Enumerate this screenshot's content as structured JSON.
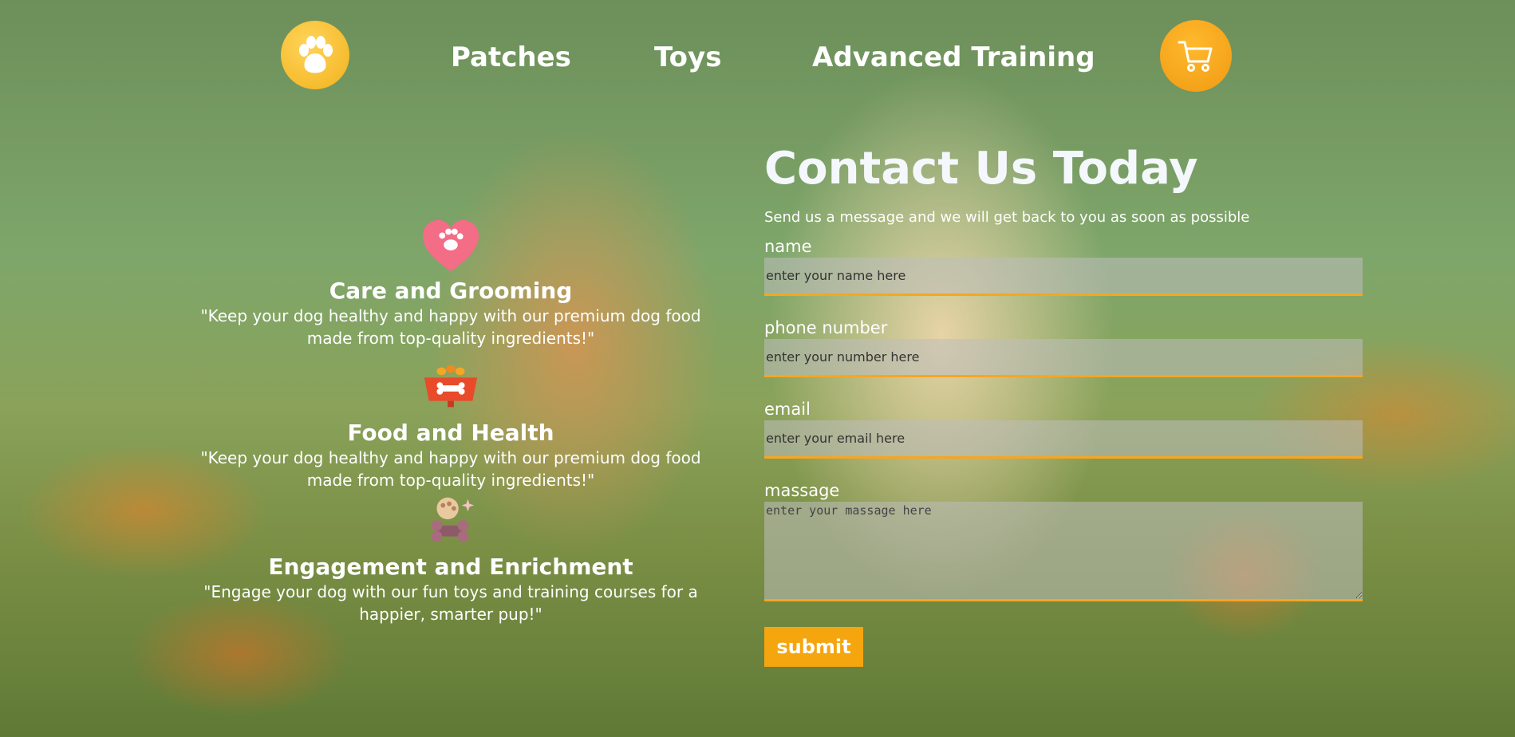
{
  "nav": {
    "links": [
      "Patches",
      "Toys",
      "Advanced Training"
    ]
  },
  "features": [
    {
      "icon": "heart-paw-icon",
      "title": "Care and Grooming",
      "text": "\"Keep your dog healthy and happy with our premium dog food made from top-quality ingredients!\""
    },
    {
      "icon": "food-bowl-icon",
      "title": "Food and Health",
      "text": "\"Keep your dog healthy and happy with our premium dog food made from top-quality ingredients!\""
    },
    {
      "icon": "toy-bone-icon",
      "title": "Engagement and Enrichment",
      "text": "\"Engage your dog with our fun toys and training courses for a happier, smarter pup!\""
    }
  ],
  "contact": {
    "title": "Contact Us Today",
    "subtitle": "Send us a message and we will get back to you as soon as possible",
    "name_label": "name",
    "name_placeholder": "enter your name here",
    "phone_label": "phone number",
    "phone_placeholder": "enter your number here",
    "email_label": "email",
    "email_placeholder": "enter your email here",
    "message_label": "massage",
    "message_placeholder": "enter your massage here",
    "submit_label": "submit"
  },
  "colors": {
    "accent": "#f5a623",
    "logo": "#f2b21c",
    "cart": "#f09a12"
  }
}
